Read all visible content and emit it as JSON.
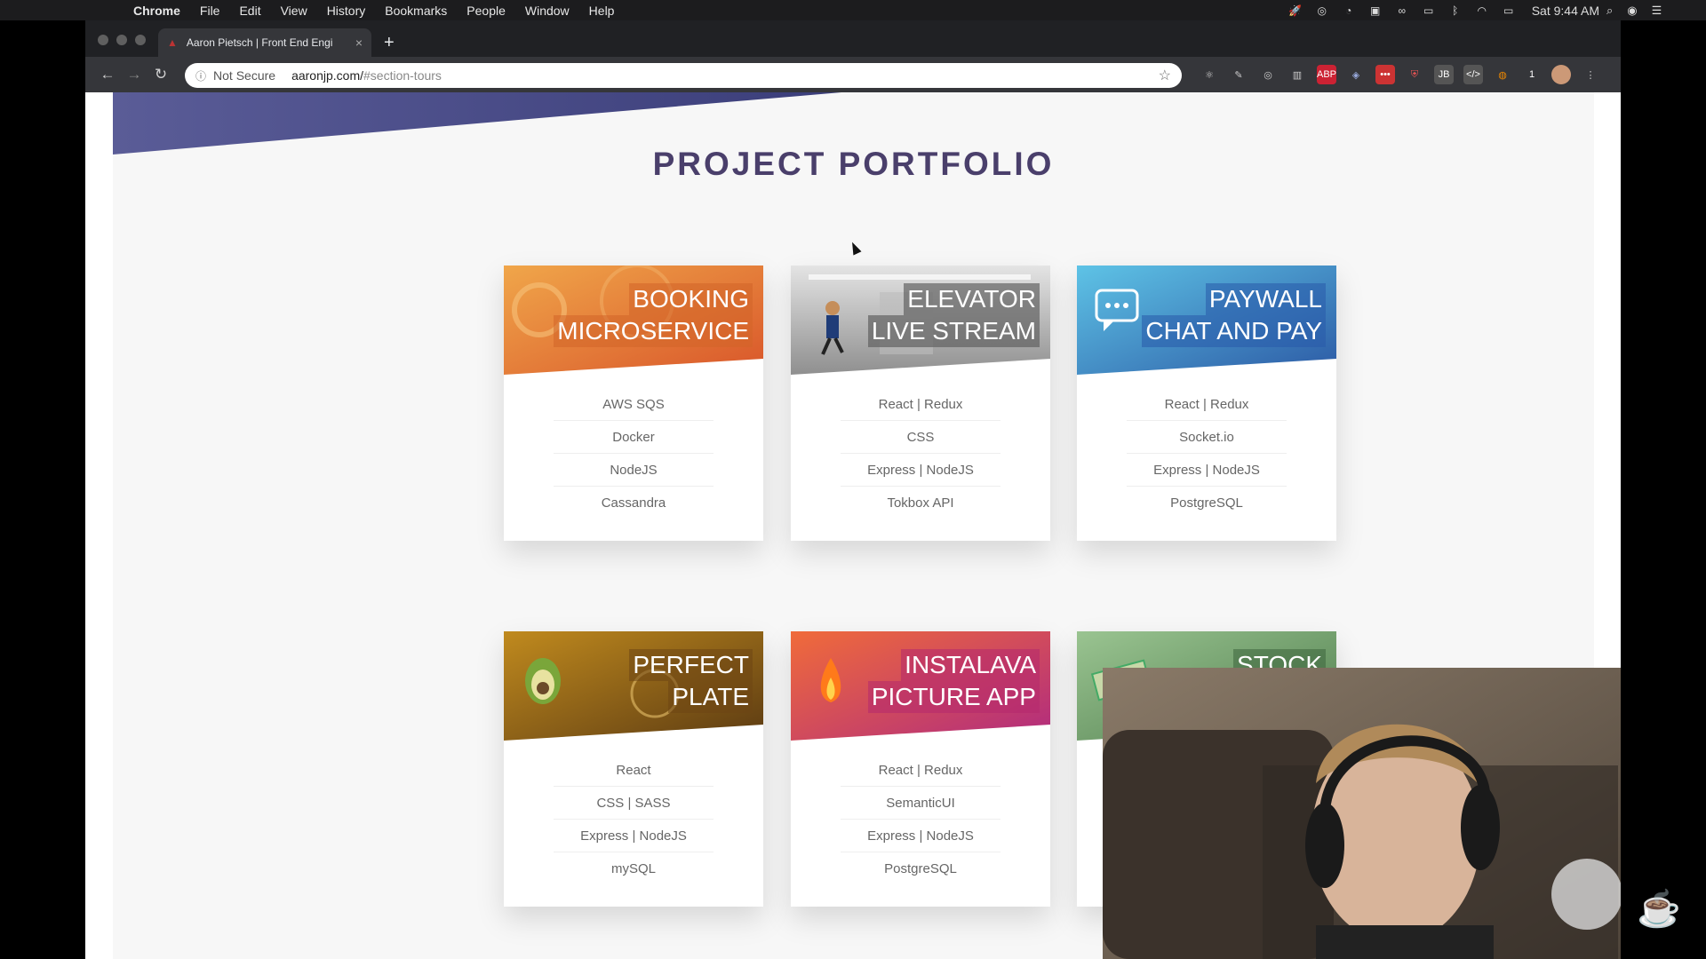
{
  "menubar": {
    "app_name": "Chrome",
    "items": [
      "File",
      "Edit",
      "View",
      "History",
      "Bookmarks",
      "People",
      "Window",
      "Help"
    ],
    "clock": "Sat 9:44 AM"
  },
  "browser": {
    "tab": {
      "title": "Aaron Pietsch | Front End Engi"
    },
    "address": {
      "security_label": "Not Secure",
      "domain": "aaronjp.com/",
      "path": "#section-tours"
    }
  },
  "page": {
    "section_title": "PROJECT PORTFOLIO",
    "cards": [
      {
        "title_line1": "BOOKING",
        "title_line2": "MICROSERVICE",
        "items": [
          "AWS SQS",
          "Docker",
          "NodeJS",
          "Cassandra"
        ],
        "gradient": [
          "#f0a64a",
          "#d9562a"
        ]
      },
      {
        "title_line1": "ELEVATOR",
        "title_line2": "LIVE STREAM",
        "items": [
          "React | Redux",
          "CSS",
          "Express | NodeJS",
          "Tokbox API"
        ],
        "gradient": [
          "#dcdcdc",
          "#8f8f8f"
        ]
      },
      {
        "title_line1": "PAYWALL",
        "title_line2": "CHAT AND PAY",
        "items": [
          "React | Redux",
          "Socket.io",
          "Express | NodeJS",
          "PostgreSQL"
        ],
        "gradient": [
          "#5ec3e6",
          "#2c5aa5"
        ]
      },
      {
        "title_line1": "PERFECT",
        "title_line2": "PLATE",
        "items": [
          "React",
          "CSS | SASS",
          "Express | NodeJS",
          "mySQL"
        ],
        "gradient": [
          "#c08a1e",
          "#5c3b12"
        ]
      },
      {
        "title_line1": "INSTALAVA",
        "title_line2": "PICTURE APP",
        "items": [
          "React | Redux",
          "SemanticUI",
          "Express | NodeJS",
          "PostgreSQL"
        ],
        "gradient": [
          "#f06b3a",
          "#b12b7f"
        ]
      },
      {
        "title_line1": "STOCK",
        "title_line2": "",
        "items": [
          "",
          "",
          "",
          ""
        ],
        "gradient": [
          "#9ac491",
          "#4f7d4d"
        ]
      }
    ]
  },
  "colors": {
    "title": "#4a3f6b",
    "hero": "#4b4f8f"
  }
}
